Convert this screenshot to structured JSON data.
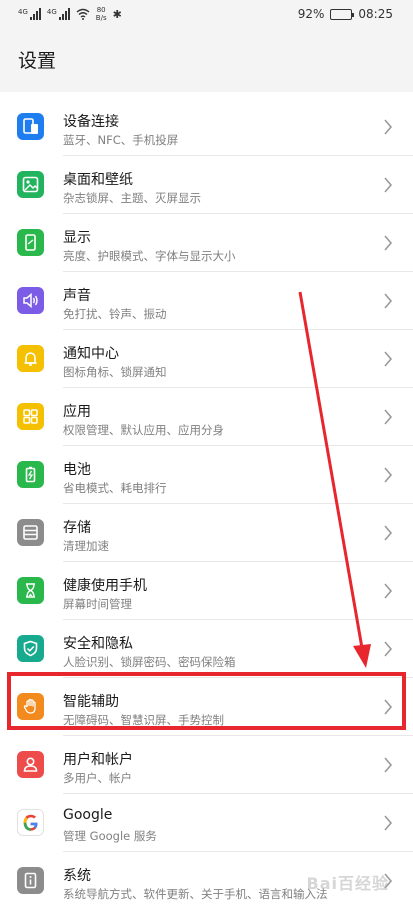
{
  "status_bar": {
    "signal1_tag": "4G",
    "signal2_tag": "4G",
    "net_speed_value": "80",
    "net_speed_unit": "B/s",
    "battery_percent": "92%",
    "battery_level": 0.92,
    "time": "08:25"
  },
  "page": {
    "title": "设置"
  },
  "items": [
    {
      "title": "设备连接",
      "subtitle": "蓝牙、NFC、手机投屏",
      "icon": "device-connection-icon",
      "color": "#1e7ef0"
    },
    {
      "title": "桌面和壁纸",
      "subtitle": "杂志锁屏、主题、灭屏显示",
      "icon": "wallpaper-icon",
      "color": "#22b35e"
    },
    {
      "title": "显示",
      "subtitle": "亮度、护眼模式、字体与显示大小",
      "icon": "display-icon",
      "color": "#2ab84c"
    },
    {
      "title": "声音",
      "subtitle": "免打扰、铃声、振动",
      "icon": "sound-icon",
      "color": "#7b5ce6"
    },
    {
      "title": "通知中心",
      "subtitle": "图标角标、锁屏通知",
      "icon": "notification-bell-icon",
      "color": "#f5c000"
    },
    {
      "title": "应用",
      "subtitle": "权限管理、默认应用、应用分身",
      "icon": "apps-grid-icon",
      "color": "#f5c000"
    },
    {
      "title": "电池",
      "subtitle": "省电模式、耗电排行",
      "icon": "battery-icon",
      "color": "#2ab84c"
    },
    {
      "title": "存储",
      "subtitle": "清理加速",
      "icon": "storage-icon",
      "color": "#8c8c8c"
    },
    {
      "title": "健康使用手机",
      "subtitle": "屏幕时间管理",
      "icon": "hourglass-icon",
      "color": "#2ab84c"
    },
    {
      "title": "安全和隐私",
      "subtitle": "人脸识别、锁屏密码、密码保险箱",
      "icon": "shield-icon",
      "color": "#18aa8f"
    },
    {
      "title": "智能辅助",
      "subtitle": "无障碍码、智慧识屏、手势控制",
      "icon": "hand-icon",
      "color": "#f28a1d"
    },
    {
      "title": "用户和帐户",
      "subtitle": "多用户、帐户",
      "icon": "user-icon",
      "color": "#ee4b4b"
    },
    {
      "title": "Google",
      "subtitle": "管理 Google 服务",
      "icon": "google-icon",
      "color": "#ffffff"
    },
    {
      "title": "系统",
      "subtitle": "系统导航方式、软件更新、关于手机、语言和输入法",
      "icon": "system-info-icon",
      "color": "#8c8c8c"
    }
  ],
  "highlighted_item_index": 10,
  "annotation_color": "#e8262e",
  "watermark": "Bai百经验"
}
